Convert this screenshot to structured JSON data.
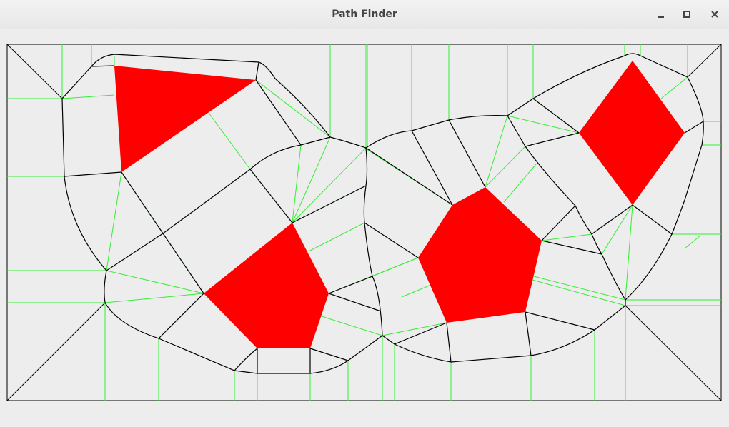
{
  "window": {
    "title": "Path Finder",
    "controls": [
      "minimize",
      "maximize",
      "close"
    ]
  },
  "colors": {
    "background": "#ededed",
    "obstacle": "#ff0000",
    "voronoi_edge": "#000000",
    "triangulation_edge": "#33ee33"
  },
  "icons": {
    "minimize": "minimize-icon",
    "maximize": "maximize-icon",
    "close": "close-icon"
  }
}
